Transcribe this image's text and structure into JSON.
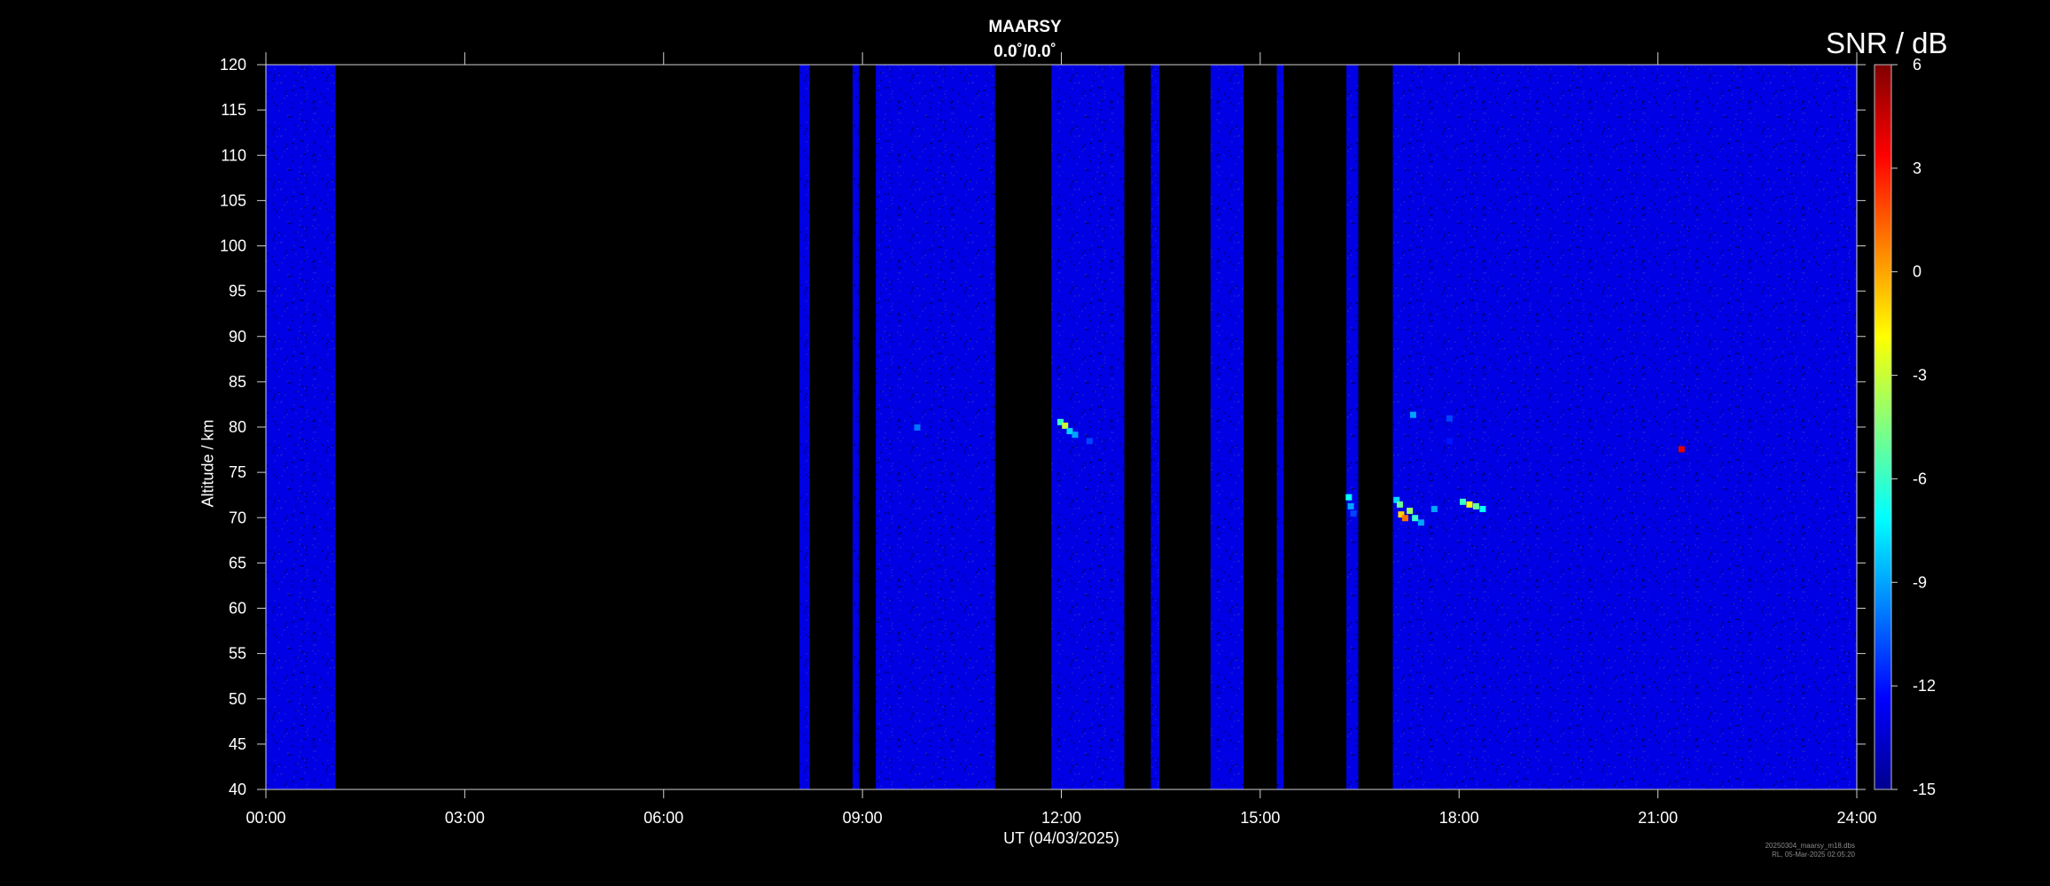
{
  "chart_data": {
    "type": "heatmap",
    "title": "MAARSY",
    "subtitle": "0.0˚/0.0˚",
    "xlabel": "UT (04/03/2025)",
    "ylabel": "Altitude / km",
    "colorbar_label": "SNR / dB",
    "x_range_hours": [
      0,
      24
    ],
    "x_ticks": [
      "00:00",
      "03:00",
      "06:00",
      "09:00",
      "12:00",
      "15:00",
      "18:00",
      "21:00",
      "24:00"
    ],
    "ylim": [
      40,
      120
    ],
    "y_ticks": [
      40,
      45,
      50,
      55,
      60,
      65,
      70,
      75,
      80,
      85,
      90,
      95,
      100,
      105,
      110,
      115,
      120
    ],
    "colorbar_range": [
      -15,
      6
    ],
    "colorbar_ticks": [
      6,
      3,
      0,
      -3,
      -6,
      -9,
      -12,
      -15
    ],
    "colormap": [
      "#00008f",
      "#0000ff",
      "#0080ff",
      "#00ffff",
      "#80ff80",
      "#ffff00",
      "#ff8000",
      "#ff0000",
      "#800000"
    ],
    "background_noise_db": -13,
    "data_intervals_ut_hours": [
      [
        0.0,
        1.05
      ],
      [
        8.05,
        8.2
      ],
      [
        8.85,
        8.95
      ],
      [
        9.2,
        11.0
      ],
      [
        11.85,
        12.95
      ],
      [
        13.35,
        13.48
      ],
      [
        14.25,
        14.75
      ],
      [
        15.25,
        15.35
      ],
      [
        16.3,
        16.48
      ],
      [
        17.0,
        24.0
      ]
    ],
    "echoes": [
      {
        "t": 9.82,
        "alt": 80.0,
        "snr": -10
      },
      {
        "t": 11.98,
        "alt": 80.6,
        "snr": -6
      },
      {
        "t": 12.05,
        "alt": 80.2,
        "snr": -3
      },
      {
        "t": 12.12,
        "alt": 79.6,
        "snr": -8
      },
      {
        "t": 12.2,
        "alt": 79.2,
        "snr": -9
      },
      {
        "t": 12.42,
        "alt": 78.5,
        "snr": -11
      },
      {
        "t": 16.33,
        "alt": 72.3,
        "snr": -7
      },
      {
        "t": 16.36,
        "alt": 71.3,
        "snr": -9
      },
      {
        "t": 16.4,
        "alt": 70.5,
        "snr": -11
      },
      {
        "t": 17.05,
        "alt": 72.0,
        "snr": -8
      },
      {
        "t": 17.1,
        "alt": 71.5,
        "snr": -5
      },
      {
        "t": 17.12,
        "alt": 70.4,
        "snr": -1
      },
      {
        "t": 17.18,
        "alt": 70.0,
        "snr": 1
      },
      {
        "t": 17.25,
        "alt": 70.8,
        "snr": -4
      },
      {
        "t": 17.33,
        "alt": 70.0,
        "snr": -6
      },
      {
        "t": 17.42,
        "alt": 69.5,
        "snr": -9
      },
      {
        "t": 17.62,
        "alt": 71.0,
        "snr": -9
      },
      {
        "t": 18.05,
        "alt": 71.8,
        "snr": -6
      },
      {
        "t": 18.15,
        "alt": 71.5,
        "snr": -2
      },
      {
        "t": 18.25,
        "alt": 71.3,
        "snr": -5
      },
      {
        "t": 18.35,
        "alt": 71.0,
        "snr": -7
      },
      {
        "t": 17.3,
        "alt": 81.4,
        "snr": -9
      },
      {
        "t": 17.85,
        "alt": 81.0,
        "snr": -11
      },
      {
        "t": 17.85,
        "alt": 78.5,
        "snr": -12
      },
      {
        "t": 21.35,
        "alt": 77.6,
        "snr": 4
      }
    ],
    "grid": false
  },
  "footnote": {
    "file": "20250304_maarsy_m18.dbs",
    "stamp": "RL, 05-Mar-2025 02:05:20"
  }
}
